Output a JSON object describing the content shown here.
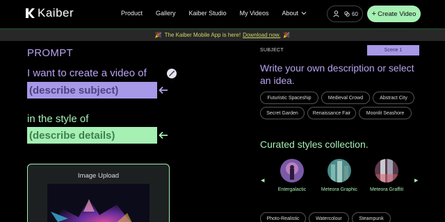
{
  "brand": {
    "name": "Kaiber"
  },
  "nav": {
    "links": [
      "Product",
      "Gallery",
      "Kaiber Studio",
      "My Videos",
      "About"
    ],
    "credits": "60",
    "create_label": "Create Video"
  },
  "banner": {
    "text": "The Kaiber Mobile App is here!",
    "link": "Download now."
  },
  "prompt": {
    "label": "PROMPT",
    "line1": "I want to create a video of",
    "subject_placeholder": "(describe subject)",
    "line2": "in the style of",
    "details_placeholder": "(describe details)"
  },
  "upload": {
    "title": "Image Upload"
  },
  "subject_panel": {
    "label": "SUBJECT",
    "scene": "Scene 1",
    "instruction": "Write your own description or select an idea.",
    "ideas": [
      "Futuristic Spaceship",
      "Medieval Crowd",
      "Abstract City",
      "Secret Garden",
      "Renaissance Fair",
      "Moonlit Seashore"
    ]
  },
  "curated": {
    "title": "Curated styles collection.",
    "styles": [
      "Entergalactic",
      "Meteora Graphic",
      "Meteora Graffiti"
    ],
    "chips": [
      "Photo-Realistic",
      "Watercolour",
      "Steampunk"
    ]
  },
  "colors": {
    "accent_purple": "#a898e8",
    "accent_green": "#a6f0b4",
    "banner_text": "#cfd56a"
  }
}
